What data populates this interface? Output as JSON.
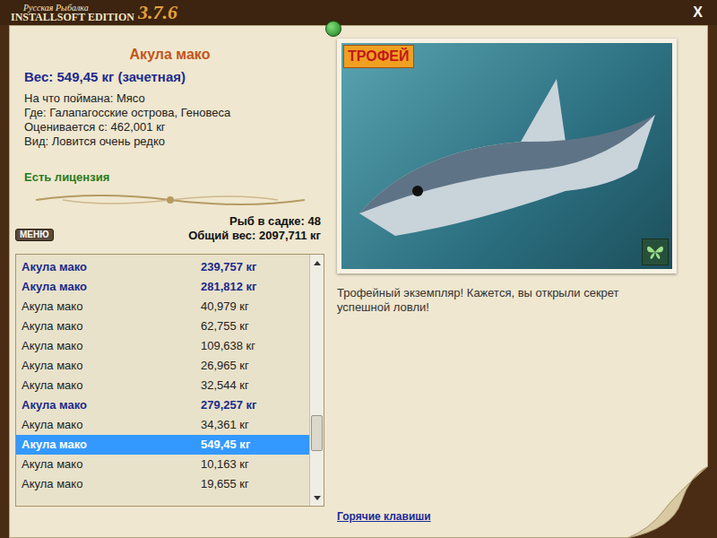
{
  "window": {
    "title_script": "Русская Рыбалка",
    "title_edition": "INSTALLSOFT EDITION",
    "version": "3.7.6",
    "close": "X"
  },
  "fish": {
    "name": "Акула мако",
    "weight": "Вес: 549,45 кг (зачетная)",
    "details": [
      "На что поймана: Мясо",
      "Где: Галапагосские острова, Геновеса",
      "Оценивается с: 462,001 кг",
      "Вид: Ловится очень редко"
    ],
    "license": "Есть лицензия"
  },
  "menu_button": "МЕНЮ",
  "keepnet": {
    "count": "Рыб в садке: 48",
    "total": "Общий вес: 2097,711 кг"
  },
  "catch_list": [
    {
      "name": "Акула мако",
      "weight": "239,757 кг",
      "trophy": true,
      "selected": false
    },
    {
      "name": "Акула мако",
      "weight": "281,812 кг",
      "trophy": true,
      "selected": false
    },
    {
      "name": "Акула мако",
      "weight": "40,979 кг",
      "trophy": false,
      "selected": false
    },
    {
      "name": "Акула мако",
      "weight": "62,755 кг",
      "trophy": false,
      "selected": false
    },
    {
      "name": "Акула мако",
      "weight": "109,638 кг",
      "trophy": false,
      "selected": false
    },
    {
      "name": "Акула мако",
      "weight": "26,965 кг",
      "trophy": false,
      "selected": false
    },
    {
      "name": "Акула мако",
      "weight": "32,544 кг",
      "trophy": false,
      "selected": false
    },
    {
      "name": "Акула мако",
      "weight": "279,257 кг",
      "trophy": true,
      "selected": false
    },
    {
      "name": "Акула мако",
      "weight": "34,361 кг",
      "trophy": false,
      "selected": false
    },
    {
      "name": "Акула мако",
      "weight": "549,45 кг",
      "trophy": true,
      "selected": true
    },
    {
      "name": "Акула мако",
      "weight": "10,163 кг",
      "trophy": false,
      "selected": false
    },
    {
      "name": "Акула мако",
      "weight": "19,655 кг",
      "trophy": false,
      "selected": false
    }
  ],
  "scrollbar": {
    "position": 0.82
  },
  "photo": {
    "badge": "ТРОФЕЙ"
  },
  "message": "Трофейный экземпляр! Кажется, вы открыли секрет успешной ловли!",
  "hotkeys_link": "Горячие клавиши"
}
